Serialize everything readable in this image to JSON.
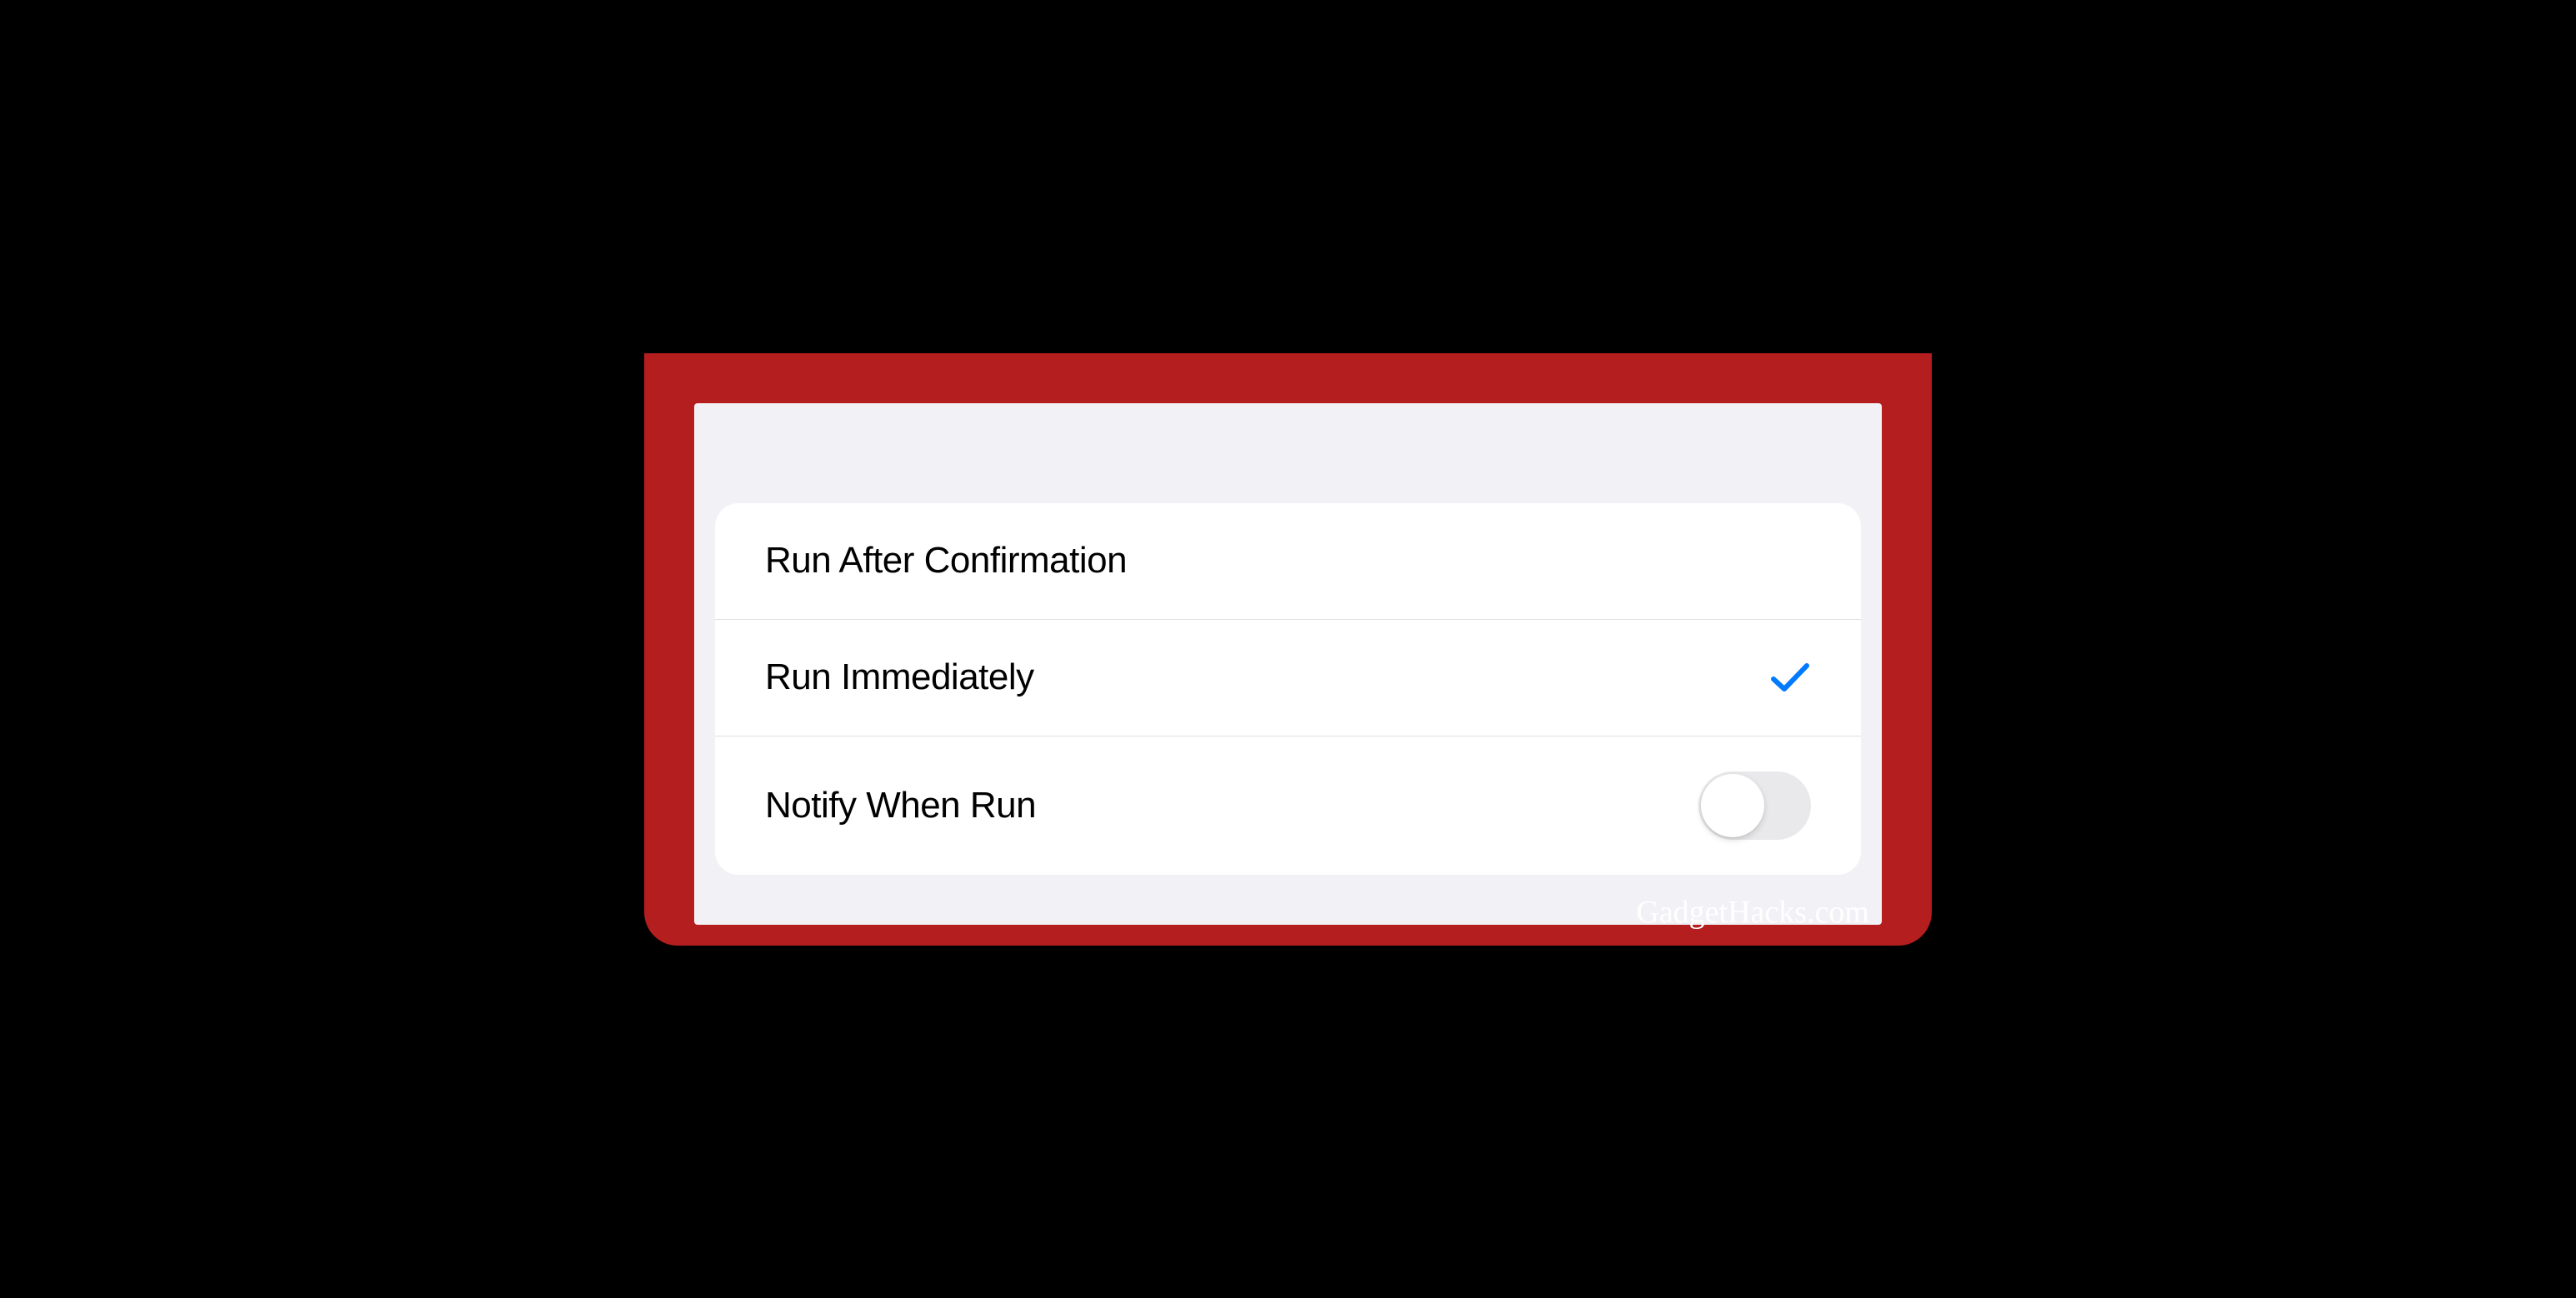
{
  "settings": {
    "rows": [
      {
        "label": "Run After Confirmation",
        "selected": false
      },
      {
        "label": "Run Immediately",
        "selected": true
      },
      {
        "label": "Notify When Run",
        "toggle": false
      }
    ]
  },
  "watermark": "GadgetHacks.com",
  "colors": {
    "frame": "#b51e1e",
    "accent": "#007aff"
  }
}
